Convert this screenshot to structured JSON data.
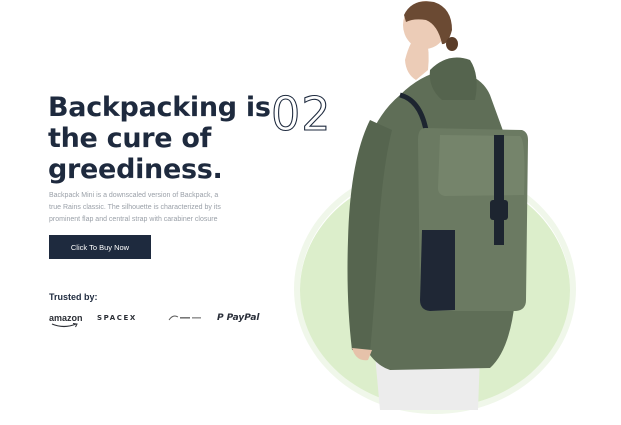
{
  "hero": {
    "title_lines": [
      "Backpacking is",
      "the cure of",
      "greediness."
    ],
    "slide_number": "02",
    "description_lines": [
      "Backpack Mini is a downscaled version of Backpack, a",
      "true Rains classic. The silhouette is characterized by its",
      "prominent flap and central strap with carabiner closure"
    ],
    "cta_label": "Click To Buy Now"
  },
  "trusted": {
    "label": "Trusted by:",
    "logos": [
      "amazon",
      "SPACEX",
      "PayPal"
    ]
  },
  "colors": {
    "navy": "#1e2a3e",
    "circle_green": "#dceecb",
    "jacket_green": "#5f6f58",
    "backpack_green": "#6b7a62"
  },
  "icons": [
    "amazon-logo-icon",
    "spacex-logo-icon",
    "brand-logo-icon",
    "paypal-logo-icon"
  ]
}
